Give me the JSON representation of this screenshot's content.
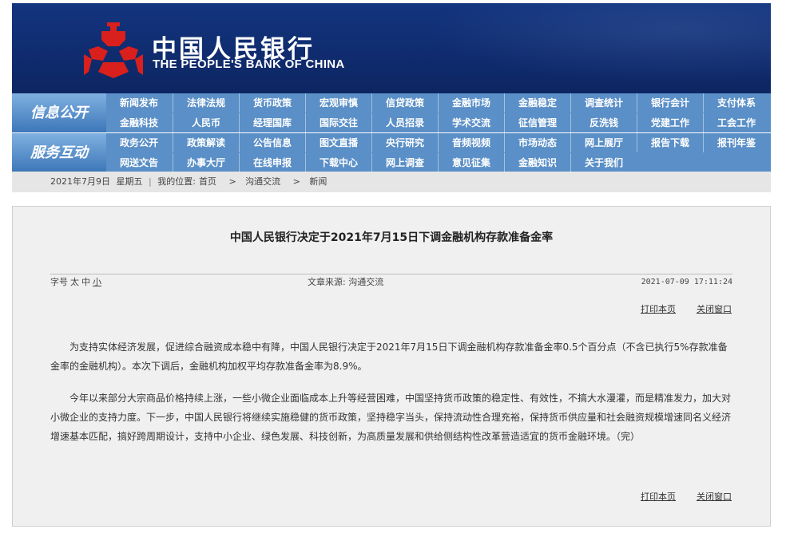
{
  "banner": {
    "title_cn": "中国人民银行",
    "title_en": "THE PEOPLE'S BANK OF CHINA"
  },
  "nav": {
    "groups": [
      {
        "label": "信息公开",
        "rows": [
          [
            "新闻发布",
            "法律法规",
            "货币政策",
            "宏观审慎",
            "信贷政策",
            "金融市场",
            "金融稳定",
            "调查统计",
            "银行会计",
            "支付体系"
          ],
          [
            "金融科技",
            "人民币",
            "经理国库",
            "国际交往",
            "人员招录",
            "学术交流",
            "征信管理",
            "反洗钱",
            "党建工作",
            "工会工作"
          ]
        ]
      },
      {
        "label": "服务互动",
        "rows": [
          [
            "政务公开",
            "政策解读",
            "公告信息",
            "图文直播",
            "央行研究",
            "音频视频",
            "市场动态",
            "网上展厅",
            "报告下载",
            "报刊年鉴"
          ],
          [
            "网送文告",
            "办事大厅",
            "在线申报",
            "下载中心",
            "网上调查",
            "意见征集",
            "金融知识",
            "关于我们"
          ]
        ]
      }
    ]
  },
  "breadcrumb": {
    "date": "2021年7月9日",
    "weekday": "星期五",
    "location_label": "我的位置:",
    "home": "首页",
    "arrow1": ">",
    "section": "沟通交流",
    "arrow2": ">",
    "current": "新闻"
  },
  "article": {
    "title": "中国人民银行决定于2021年7月15日下调金融机构存款准备金率",
    "font_size_label": "字号",
    "font_large": "太",
    "font_medium": "中",
    "font_small": "小",
    "source": "文章来源: 沟通交流",
    "datetime": "2021-07-09 17:11:24",
    "print": "打印本页",
    "close": "关闭窗口",
    "paragraphs": [
      "为支持实体经济发展，促进综合融资成本稳中有降，中国人民银行决定于2021年7月15日下调金融机构存款准备金率0.5个百分点（不含已执行5%存款准备金率的金融机构）。本次下调后，金融机构加权平均存款准备金率为8.9%。",
      "今年以来部分大宗商品价格持续上涨，一些小微企业面临成本上升等经营困难，中国坚持货币政策的稳定性、有效性，不搞大水漫灌，而是精准发力，加大对小微企业的支持力度。下一步，中国人民银行将继续实施稳健的货币政策，坚持稳字当头，保持流动性合理充裕，保持货币供应量和社会融资规模增速同名义经济增速基本匹配，搞好跨周期设计，支持中小企业、绿色发展、科技创新，为高质量发展和供给侧结构性改革营造适宜的货币金融环境。（完）"
    ]
  }
}
